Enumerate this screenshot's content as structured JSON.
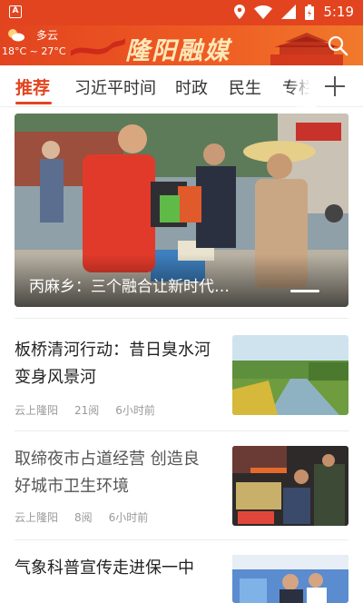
{
  "status_bar": {
    "time": "5:19",
    "app_indicator": "A",
    "icons": [
      "location-icon",
      "wifi-icon",
      "signal-icon",
      "battery-icon"
    ]
  },
  "header": {
    "weather_condition": "多云",
    "temperature": "18°C ~ 27°C",
    "logo_text": "隆阳融媒",
    "icons": [
      "weather-sun-icon",
      "search-icon"
    ]
  },
  "tabs": {
    "items": [
      {
        "label": "推荐",
        "active": true
      },
      {
        "label": "习近平时间",
        "active": false
      },
      {
        "label": "时政",
        "active": false
      },
      {
        "label": "民生",
        "active": false
      },
      {
        "label": "专栏",
        "active": false
      }
    ],
    "add_icon": "plus-icon"
  },
  "hero": {
    "title": "丙麻乡：三个融合让新时代…"
  },
  "articles": [
    {
      "title": "板桥清河行动：昔日臭水河变身风景河",
      "source": "云上隆阳",
      "reads": "21阅",
      "time": "6小时前"
    },
    {
      "title": "取缔夜市占道经营 创造良好城市卫生环境",
      "source": "云上隆阳",
      "reads": "8阅",
      "time": "6小时前"
    },
    {
      "title": "气象科普宣传走进保一中",
      "source": "",
      "reads": "",
      "time": ""
    }
  ],
  "colors": {
    "brand": "#e2441f",
    "header_gradient_end": "#f17a2b",
    "logo_text": "#fde8b8",
    "text_primary": "#222222",
    "text_meta": "#999999"
  }
}
